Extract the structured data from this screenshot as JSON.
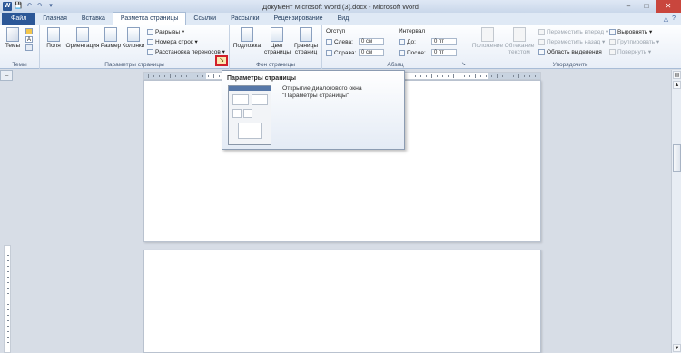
{
  "window": {
    "title": "Документ Microsoft Word (3).docx - Microsoft Word",
    "controls": {
      "minimize": "–",
      "maximize": "□",
      "close": "✕"
    }
  },
  "qat": {
    "logo": "W",
    "save": "💾",
    "undo": "↶",
    "redo": "↷",
    "more": "▾"
  },
  "tabs": [
    {
      "label": "Файл"
    },
    {
      "label": "Главная"
    },
    {
      "label": "Вставка"
    },
    {
      "label": "Разметка страницы"
    },
    {
      "label": "Ссылки"
    },
    {
      "label": "Рассылки"
    },
    {
      "label": "Рецензирование"
    },
    {
      "label": "Вид"
    }
  ],
  "ribbon": {
    "themes": {
      "button": "Темы",
      "group": "Темы"
    },
    "page_setup": {
      "group": "Параметры страницы",
      "margins": "Поля",
      "orientation": "Ориентация",
      "size": "Размер",
      "columns": "Колонки",
      "breaks": "Разрывы",
      "line_numbers": "Номера строк",
      "hyphenation": "Расстановка переносов"
    },
    "page_background": {
      "group": "Фон страницы",
      "watermark": "Подложка",
      "page_color": "Цвет страницы",
      "page_borders": "Границы страниц"
    },
    "paragraph": {
      "group": "Абзац",
      "indent_label": "Отступ",
      "left_label": "Слева:",
      "left_value": "0 см",
      "right_label": "Справа:",
      "right_value": "0 см",
      "spacing_label": "Интервал",
      "before_label": "До:",
      "before_value": "0 пт",
      "after_label": "После:",
      "after_value": "0 пт"
    },
    "arrange": {
      "group": "Упорядочить",
      "position": "Положение",
      "wrap_text": "Обтекание текстом",
      "bring_forward": "Переместить вперед",
      "send_backward": "Переместить назад",
      "selection_pane": "Область выделения",
      "align": "Выровнять",
      "group_btn": "Группировать",
      "rotate": "Повернуть"
    }
  },
  "tooltip": {
    "title": "Параметры страницы",
    "description": "Открытие диалогового окна \"Параметры страницы\"."
  }
}
